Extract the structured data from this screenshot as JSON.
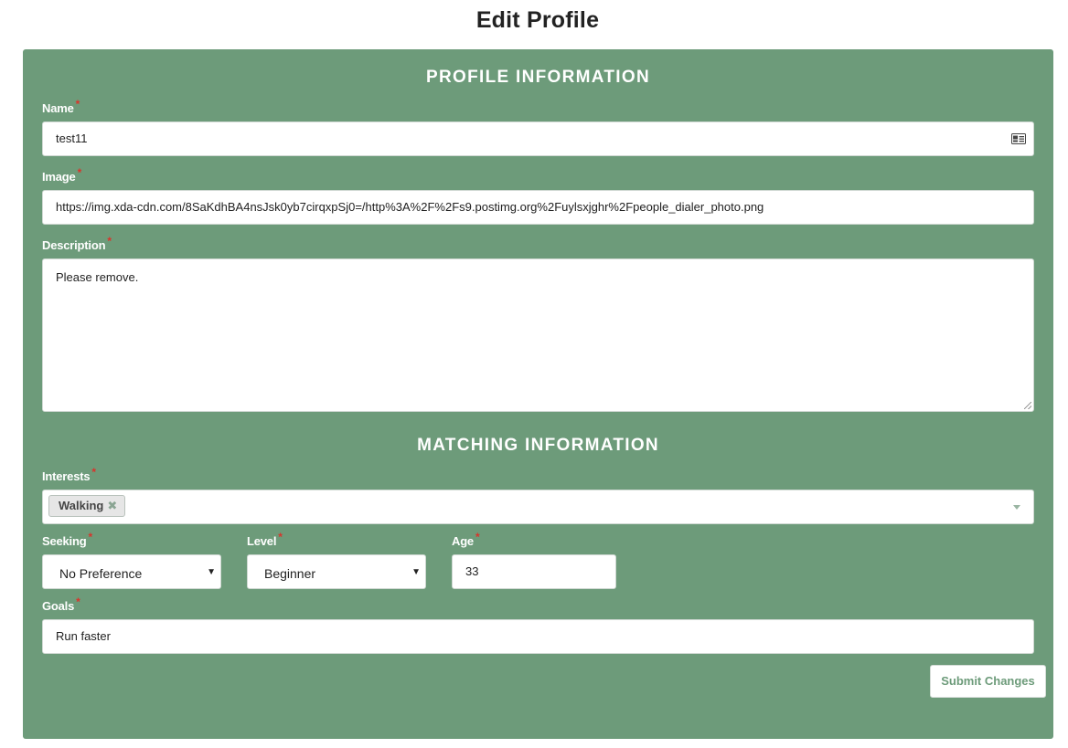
{
  "page": {
    "title": "Edit Profile"
  },
  "profile": {
    "section_title": "PROFILE INFORMATION",
    "name_label": "Name",
    "name_value": "test11",
    "image_label": "Image",
    "image_value": "https://img.xda-cdn.com/8SaKdhBA4nsJsk0yb7cirqxpSj0=/http%3A%2F%2Fs9.postimg.org%2Fuylsxjghr%2Fpeople_dialer_photo.png",
    "description_label": "Description",
    "description_value": "Please remove."
  },
  "matching": {
    "section_title": "MATCHING INFORMATION",
    "interests_label": "Interests",
    "interests_tags": [
      "Walking"
    ],
    "seeking_label": "Seeking",
    "seeking_value": "No Preference",
    "level_label": "Level",
    "level_value": "Beginner",
    "age_label": "Age",
    "age_value": "33",
    "goals_label": "Goals",
    "goals_value": "Run faster"
  },
  "actions": {
    "submit_label": "Submit Changes"
  },
  "required_marker": "*",
  "tag_remove_glyph": "✖",
  "select_arrow_glyph": "▼",
  "icons": {
    "name_field_icon": "contact-card-icon",
    "interests_dropdown_icon": "caret-down-icon"
  },
  "colors": {
    "panel_background": "#6d9b7a",
    "required_marker": "#d9342b",
    "submit_text": "#6d9b7a"
  }
}
